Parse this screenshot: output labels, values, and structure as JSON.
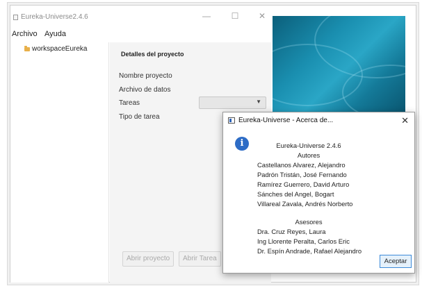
{
  "window": {
    "title": "Eureka-Universe2.4.6",
    "controls": {
      "minimize": "—",
      "maximize": "☐",
      "close": "✕"
    }
  },
  "menu": [
    "Archivo",
    "Ayuda"
  ],
  "sidebar": {
    "items": [
      {
        "label": "workspaceEureka",
        "icon": "folder-icon"
      }
    ]
  },
  "main": {
    "section_title": "Detalles del proyecto",
    "fields": [
      "Nombre proyecto",
      "Archivo de datos",
      "Tareas",
      "Tipo de tarea"
    ],
    "combo_arrow": "▼",
    "buttons": [
      "Abrir proyecto",
      "Abrir Tarea"
    ]
  },
  "dialog": {
    "title": "Eureka-Universe - Acerca de...",
    "close": "✕",
    "info_glyph": "i",
    "heading_version": "Eureka-Universe 2.4.6",
    "heading_authors": "Autores",
    "authors": [
      "Castellanos Alvarez, Alejandro",
      "Padrón Tristán, José Fernando",
      "Ramírez Guerrero, David Arturo",
      "Sánches del Angel, Bogart",
      "Villareal Zavala, Andrés Norberto"
    ],
    "heading_advisors": "Asesores",
    "advisors": [
      "Dra. Cruz Reyes, Laura",
      "Ing Llorente Peralta, Carlos Eric",
      "Dr. Espín Andrade, Rafael Alejandro"
    ],
    "ok_label": "Aceptar"
  },
  "colors": {
    "accent": "#2d6cc6",
    "ok_border": "#3c8ad8",
    "folder": "#e8b04a"
  }
}
